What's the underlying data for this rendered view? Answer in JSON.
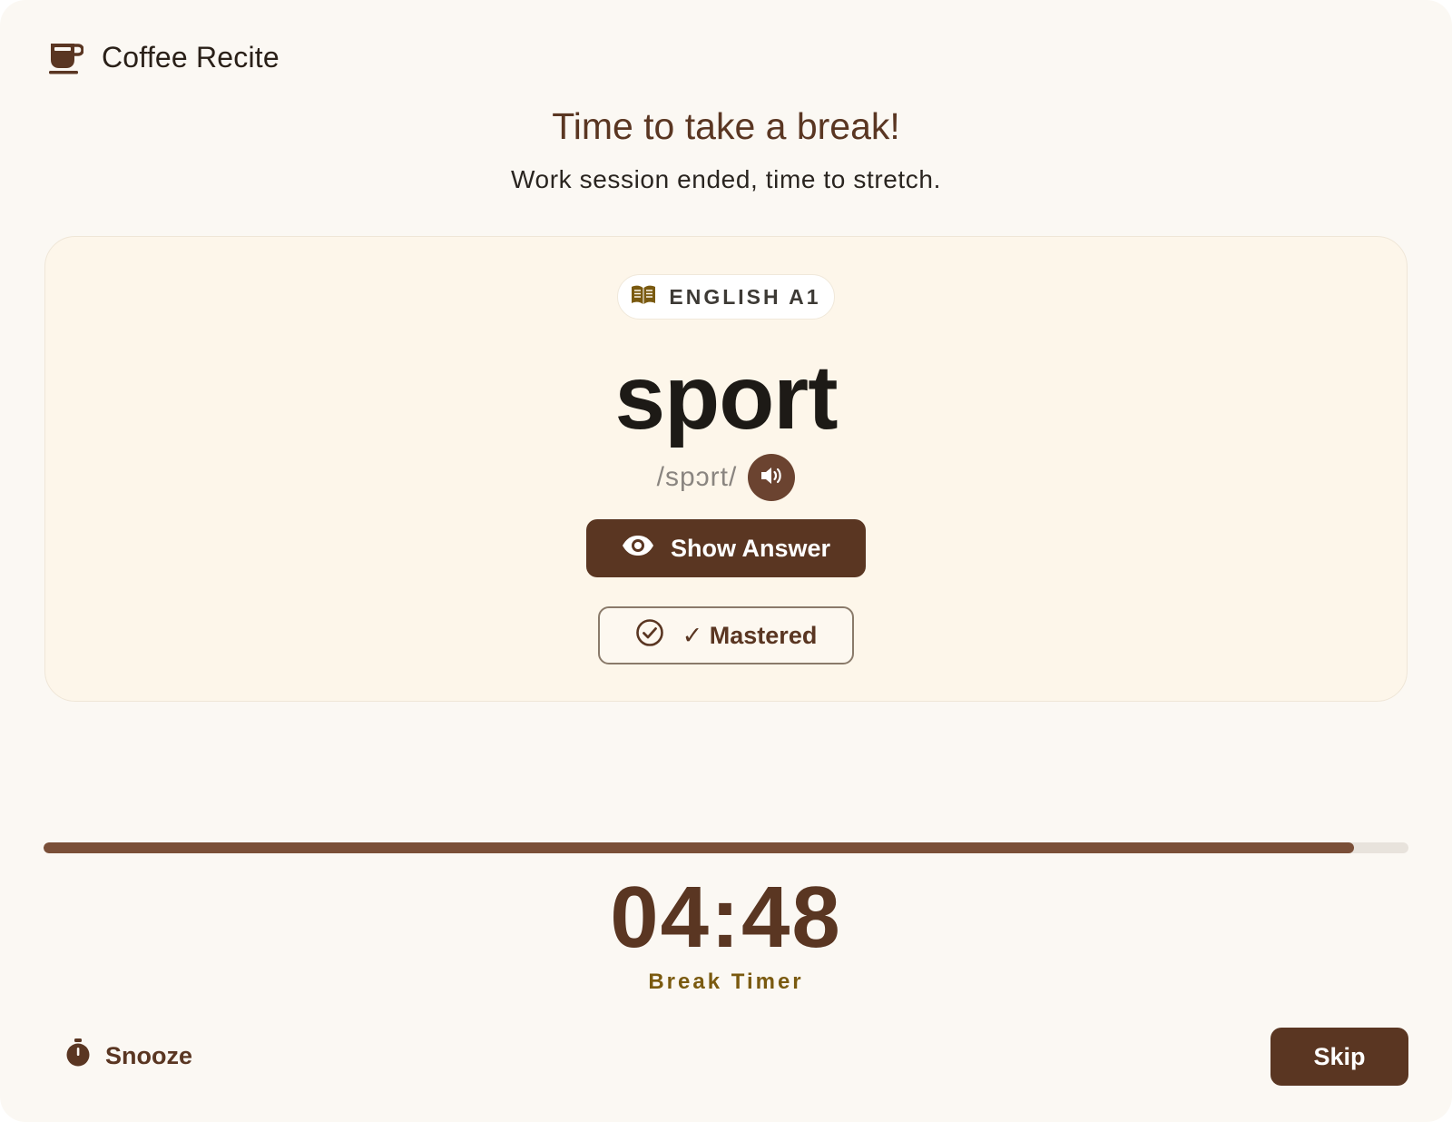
{
  "app": {
    "name": "Coffee Recite",
    "logo_icon": "coffee-cup-icon"
  },
  "header": {
    "title": "Time to take a break!",
    "subtitle": "Work session ended, time to stretch."
  },
  "card": {
    "tag": {
      "icon": "book-icon",
      "label": "ENGLISH A1"
    },
    "word": "sport",
    "phonetic": "/spɔrt/",
    "audio_icon": "speaker-icon",
    "show_answer": {
      "icon": "eye-icon",
      "label": "Show Answer"
    },
    "mastered": {
      "icon": "check-circle-icon",
      "label": "✓ Mastered"
    }
  },
  "timer": {
    "progress": 0.96,
    "value": "04:48",
    "label": "Break Timer"
  },
  "footer": {
    "snooze": {
      "icon": "stopwatch-icon",
      "label": "Snooze"
    },
    "skip": {
      "label": "Skip"
    }
  },
  "colors": {
    "accent": "#5a3622",
    "background": "#fbf8f3",
    "card": "#fdf6ea",
    "timer_label": "#7a5a10"
  }
}
